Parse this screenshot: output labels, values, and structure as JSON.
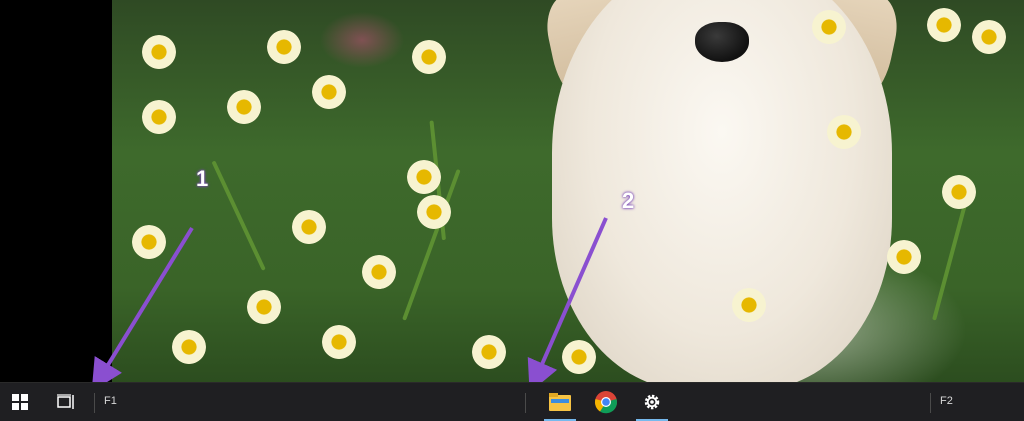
{
  "annotations": {
    "callout_1": "1",
    "callout_2": "2",
    "arrow_color": "#8a4fd0"
  },
  "taskbar": {
    "label_left": "F1",
    "label_right": "F2",
    "icons": {
      "start": "windows-icon",
      "task_view": "task-view-icon",
      "explorer": "file-explorer-icon",
      "chrome": "chrome-icon",
      "settings": "gear-icon"
    },
    "accent": "#76b9ed"
  }
}
